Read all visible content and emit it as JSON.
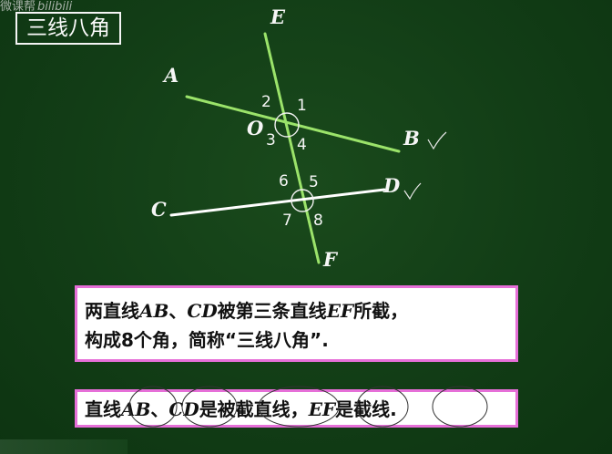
{
  "watermark": {
    "left": "微课帮",
    "right": "bilibili"
  },
  "title": "三线八角",
  "points": {
    "A": "A",
    "B": "B",
    "C": "C",
    "D": "D",
    "E": "E",
    "F": "F",
    "O": "O"
  },
  "angles": [
    "1",
    "2",
    "3",
    "4",
    "5",
    "6",
    "7",
    "8"
  ],
  "box1": {
    "line1": {
      "p1": "两直线",
      "ab": "AB",
      "p2": "、",
      "cd": "CD",
      "p3": "被第三条直线",
      "ef": "EF",
      "p4": "所截，"
    },
    "line2": "构成8个角，简称“三线八角”."
  },
  "box2": {
    "p1": "直线",
    "ab": "AB",
    "p2": "、",
    "cd": "CD",
    "p3": "是被截直线，",
    "ef": "EF",
    "p4": "是截线."
  },
  "colors": {
    "board": "#123d16",
    "transversal": "#9be36a",
    "lineAB": "#9be36a",
    "lineCD": "#ffffff",
    "boxBorder": "#e66fd8"
  }
}
